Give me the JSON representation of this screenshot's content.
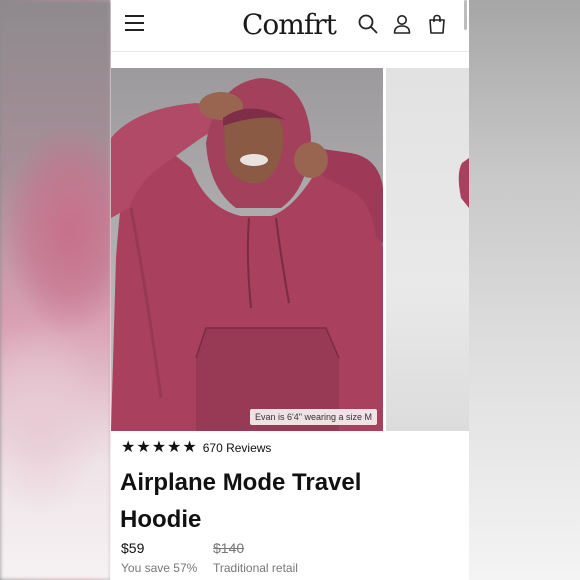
{
  "header": {
    "brand": "Comfrt",
    "icons": [
      "menu-icon",
      "search-icon",
      "account-icon",
      "bag-icon"
    ]
  },
  "gallery": {
    "caption": "Evan is 6'4\" wearing a size M",
    "product_color": "#a8405e"
  },
  "product": {
    "rating_stars": 5,
    "reviews_label": "670 Reviews",
    "title": "Airplane Mode Travel Hoodie",
    "price": "$59",
    "original_price": "$140",
    "savings": "You save 57%",
    "original_label": "Traditional retail"
  }
}
